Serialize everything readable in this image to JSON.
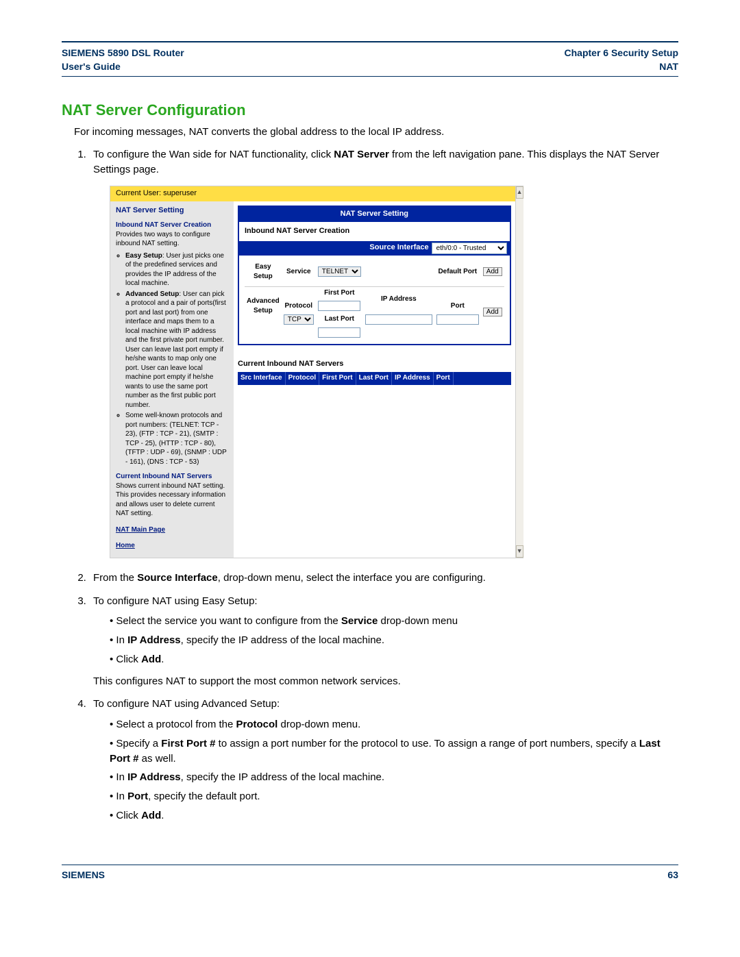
{
  "header": {
    "left_line1": "SIEMENS 5890 DSL Router",
    "left_line2": "User's Guide",
    "right_line1": "Chapter 6  Security Setup",
    "right_line2": "NAT"
  },
  "section_title": "NAT Server Configuration",
  "intro": "For incoming messages, NAT converts the global address to the local IP address.",
  "steps": {
    "s1_a": "To configure the Wan side for NAT functionality, click ",
    "s1_b_bold": "NAT Server",
    "s1_c": " from the left navigation pane. This displays the NAT Server Settings page.",
    "s2_a": "From the ",
    "s2_b_bold": "Source Interface",
    "s2_c": ", drop-down menu, select the interface you are configuring.",
    "s3_intro": "To configure NAT using Easy Setup:",
    "s3_b1_a": "Select the service you want to configure from the ",
    "s3_b1_b_bold": "Service",
    "s3_b1_c": " drop-down menu",
    "s3_b2_a": "In ",
    "s3_b2_b_bold": "IP Address",
    "s3_b2_c": ", specify the IP address of the local machine.",
    "s3_b3_a": "Click ",
    "s3_b3_b_bold": "Add",
    "s3_b3_c": ".",
    "s3_after": "This configures NAT to support the most common network services.",
    "s4_intro": "To configure NAT using Advanced Setup:",
    "s4_b1_a": "Select a protocol from the ",
    "s4_b1_b_bold": "Protocol",
    "s4_b1_c": " drop-down menu.",
    "s4_b2_a": "Specify a ",
    "s4_b2_b_bold": "First Port #",
    "s4_b2_c": " to assign a port number for the protocol to use. To assign a range of port numbers, specify a ",
    "s4_b2_d_bold": "Last Port #",
    "s4_b2_e": " as well.",
    "s4_b3_a": "In ",
    "s4_b3_b_bold": "IP Address",
    "s4_b3_c": ", specify the IP address of the local machine.",
    "s4_b4_a": "In ",
    "s4_b4_b_bold": "Port",
    "s4_b4_c": ", specify the default port.",
    "s4_b5_a": "Click ",
    "s4_b5_b_bold": "Add",
    "s4_b5_c": "."
  },
  "router": {
    "current_user_prefix": "Current User: ",
    "current_user": "superuser",
    "left": {
      "title": "NAT Server Setting",
      "inbound_heading": "Inbound NAT Server Creation",
      "inbound_desc": "Provides two ways to configure inbound NAT setting.",
      "easy_b": "Easy Setup",
      "easy_text": ": User just picks one of the predefined services and provides the IP address of the local machine.",
      "adv_b": "Advanced Setup",
      "adv_text": ": User can pick a protocol and a pair of ports(first port and last port) from one interface and maps them to a local machine with IP address and the first private port number. User can leave last port empty if he/she wants to map only one port. User can leave local machine port empty if he/she wants to use the same port number as the first public port number.",
      "proto_text": "Some well-known protocols and port numbers: (TELNET: TCP - 23), (FTP : TCP - 21), (SMTP : TCP - 25), (HTTP : TCP - 80), (TFTP : UDP - 69), (SNMP : UDP - 161), (DNS : TCP - 53)",
      "current_heading": "Current Inbound NAT Servers",
      "current_desc": "Shows current inbound NAT setting. This provides necessary information and allows user to delete current NAT setting.",
      "link_main": "NAT Main Page",
      "link_home": "Home"
    },
    "right": {
      "group_title": "NAT Server Setting",
      "inbound_title": "Inbound NAT Server Creation",
      "src_label": "Source Interface",
      "src_value": "eth/0:0 - Trusted",
      "easy_setup": "Easy Setup",
      "service": "Service",
      "service_value": "TELNET",
      "default_port": "Default Port",
      "advanced_setup": "Advanced Setup",
      "protocol": "Protocol",
      "protocol_value": "TCP",
      "first_port": "First Port",
      "last_port": "Last Port",
      "ip_address": "IP Address",
      "port": "Port",
      "add": "Add",
      "current_title": "Current Inbound NAT Servers",
      "headers": [
        "Src Interface",
        "Protocol",
        "First Port",
        "Last Port",
        "IP Address",
        "Port",
        ""
      ]
    },
    "scrollbar": {
      "up": "▲",
      "down": "▼"
    }
  },
  "footer": {
    "brand": "SIEMENS",
    "page": "63"
  }
}
